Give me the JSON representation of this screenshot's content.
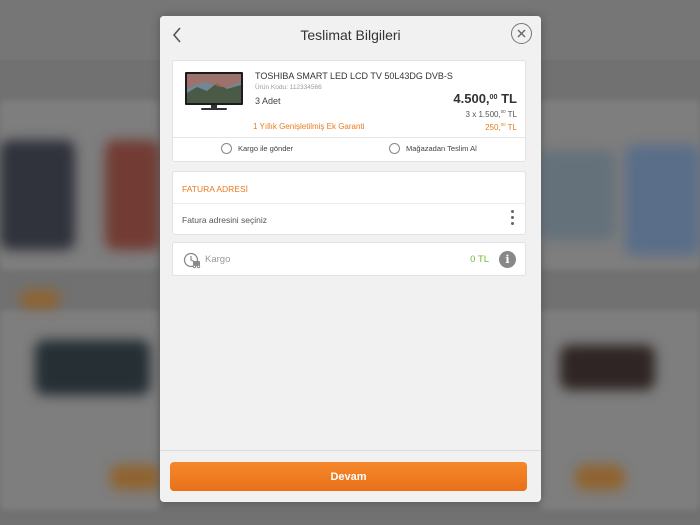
{
  "modal": {
    "title": "Teslimat Bilgileri",
    "back_icon": "chevron-left-icon",
    "close_icon": "close-icon"
  },
  "product": {
    "name": "TOSHIBA SMART LED LCD TV 50L43DG DVB-S",
    "code": "Ürün Kodu: 112334566",
    "quantity": "3 Adet",
    "price_main": "4.500,",
    "price_cents": "00",
    "price_currency": " TL",
    "unit_prefix": "3 x 1.500,",
    "unit_cents": "00",
    "unit_currency": " TL",
    "warranty_label": "1 Yıllık Genişletilmiş Ek Garanti",
    "warranty_main": "250,",
    "warranty_cents": "00",
    "warranty_currency": " TL"
  },
  "delivery_options": [
    {
      "label": "Kargo ile gönder",
      "selected": false
    },
    {
      "label": "Mağazadan Teslim Al",
      "selected": false
    }
  ],
  "invoice": {
    "title": "FATURA ADRESİ",
    "select_label": "Fatura adresini seçiniz"
  },
  "shipping": {
    "label": "Kargo",
    "value": "0 TL",
    "icon": "shipping-clock-icon",
    "info_icon": "info-icon"
  },
  "footer": {
    "continue_label": "Devam"
  },
  "colors": {
    "accent": "#e87c1e",
    "success": "#6bbf35",
    "button_top": "#f6882a",
    "button_bottom": "#e8701a"
  }
}
